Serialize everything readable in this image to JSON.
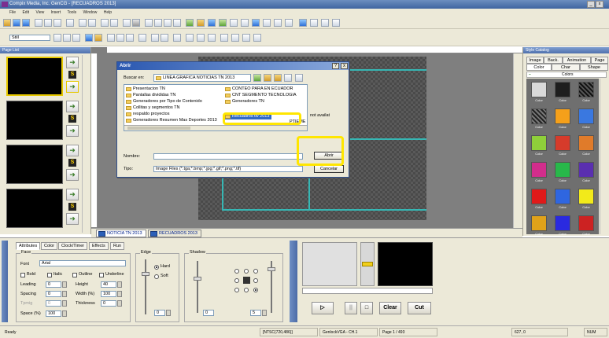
{
  "window": {
    "title": "Compix Media, Inc. GenCG - [RECUADROS 2013]",
    "controls": [
      "_",
      "□",
      "x"
    ]
  },
  "menu": [
    "File",
    "Edit",
    "View",
    "Insert",
    "Tools",
    "Window",
    "Help"
  ],
  "toolbar2": {
    "font_select": "Still"
  },
  "left_panel": {
    "title": "Page List",
    "pages": [
      {
        "number": "1",
        "selected": true
      },
      {
        "number": "2",
        "selected": false
      },
      {
        "number": "3",
        "selected": false
      },
      {
        "number": "4",
        "selected": false
      }
    ]
  },
  "dialog": {
    "title": "Abrir",
    "help": "?",
    "close": "x",
    "buscar_label": "Buscar en:",
    "buscar_value": "LINEA GRAFICA NOTICIAS TN 2013",
    "files_col1": [
      "Presentacion TN",
      "Pantallas divididas TN",
      "Generadores por Tipo de Contenido",
      "Collitas y segmentos TN",
      "respaldo proyectos",
      "Generadores Resumen Mas Deportes 2013"
    ],
    "files_col2": [
      "CONTEO PARA EN ECUADOR",
      "CNT SEGMENTO TECNOLOGIA",
      "Generadores TN",
      "Recuadros tlv 2013",
      "PTIEME"
    ],
    "overflow_text": "not availat",
    "nombre_label": "Nombre:",
    "nombre_value": "",
    "tipo_label": "Tipo:",
    "tipo_value": "Image Files (*.tga;*.bmp;*.jpg;*.gif;*.png;*.tif)",
    "abrir": "Abrir",
    "cancelar": "Cancelar",
    "highlight_color": "#ffe600"
  },
  "doc_tabs": [
    "NOTICIA TN 2013",
    "RECUADROS 2013"
  ],
  "right_panel": {
    "title": "Style Catalog",
    "tabs_row1": [
      "Image",
      "Back.",
      "Animation",
      "Page"
    ],
    "tabs_row2": [
      "Color",
      "Char",
      "Shape"
    ],
    "group_label": "Colors",
    "swatch_label": "Color",
    "swatches": [
      "#d9d9d9",
      "#1e1e1e",
      "#3a3a3a",
      "#2a2a2a",
      "#f5a01a",
      "#3a78e0",
      "#8fcf3a",
      "#d63b2b",
      "#e07b2a",
      "#d22d8c",
      "#28b84a",
      "#5a2fb0",
      "#e01a1a",
      "#2f66e0",
      "#f2ea1a",
      "#e0a21a",
      "#2a2ae0",
      "#cc2222"
    ]
  },
  "bottom_panel": {
    "side_label": "Attributes",
    "tabs": [
      "Attributes",
      "Color",
      "Clock/Timer",
      "Effects",
      "Run"
    ],
    "face": {
      "label": "Face",
      "font_label": "Font",
      "font_value": "Arial",
      "checks": [
        "Bold",
        "Italic",
        "Outline",
        "Underline"
      ],
      "leading_label": "Leading",
      "leading_value": "0",
      "height_label": "Height",
      "height_value": "40",
      "spacing_label": "Spacing",
      "spacing_value": "0",
      "width_label": "Width (%)",
      "width_value": "100",
      "tpmig_label": "Tpmig",
      "tpmig_value": "0",
      "thickness_label": "Thickness",
      "thickness_value": "0",
      "space_label": "Space (%)",
      "space_value": "100"
    },
    "edge": {
      "label": "Edge",
      "hard": "Hard",
      "soft": "Soft",
      "value": "0"
    },
    "shadow": {
      "label": "Shadow",
      "value1": "0",
      "value2": "5"
    },
    "playback": {
      "clear": "Clear",
      "cut": "Cut",
      "play_icon": "▷",
      "pause_icon": "||",
      "stop_icon": "□"
    }
  },
  "status": {
    "ready": "Ready",
    "format": "[NTSC(720,486)]",
    "device": "GenlockVGA - CH.1",
    "page": "Page 1 / 493",
    "coords": "627, 0",
    "num": "NUM"
  }
}
